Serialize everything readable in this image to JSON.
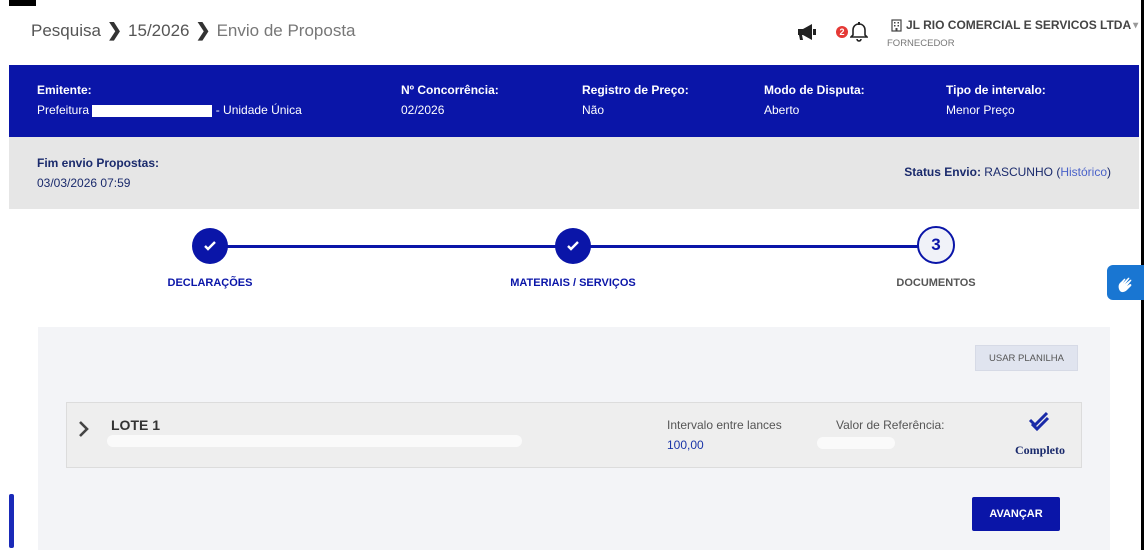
{
  "header": {
    "breadcrumb": [
      "Pesquisa",
      "15/2026",
      "Envio de Proposta"
    ],
    "notification_count": "2",
    "company_name": "JL RIO COMERCIAL E SERVICOS LTDA",
    "user_role": "FORNECEDOR"
  },
  "info": {
    "emitente_label": "Emitente:",
    "emitente_prefix": "Prefeitura",
    "emitente_suffix": "- Unidade Única",
    "concorrencia_label": "Nº Concorrência:",
    "concorrencia_value": "02/2026",
    "registro_label": "Registro de Preço:",
    "registro_value": "Não",
    "modo_label": "Modo de Disputa:",
    "modo_value": "Aberto",
    "tipo_label": "Tipo de intervalo:",
    "tipo_value": "Menor Preço"
  },
  "deadline": {
    "label": "Fim envio Propostas:",
    "value": "03/03/2026 07:59"
  },
  "status": {
    "label": "Status Envio:",
    "value": "RASCUNHO",
    "open_paren": "(",
    "history_link": "Histórico",
    "close_paren": ")"
  },
  "stepper": {
    "steps": [
      {
        "label": "DECLARAÇÕES",
        "state": "done"
      },
      {
        "label": "MATERIAIS / SERVIÇOS",
        "state": "done"
      },
      {
        "label": "DOCUMENTOS",
        "state": "current",
        "number": "3"
      }
    ]
  },
  "panel": {
    "usar_planilha": "USAR PLANILHA",
    "lote": {
      "title": "LOTE 1",
      "intervalo_label": "Intervalo entre lances",
      "intervalo_value": "100,00",
      "referencia_label": "Valor de Referência:",
      "status_label": "Completo"
    },
    "avancar": "AVANÇAR"
  },
  "colors": {
    "primary": "#0a15a8",
    "info_band": "#0a15a8",
    "gray_band": "#e6e6e6",
    "badge": "#e53935",
    "accessibility": "#1976d2"
  },
  "icons": {
    "megaphone": "megaphone-icon",
    "bell": "bell-icon",
    "building": "building-icon",
    "check": "check-icon",
    "chevron": "chevron-right-icon",
    "double_check": "double-check-icon",
    "accessibility": "sign-language-icon"
  }
}
